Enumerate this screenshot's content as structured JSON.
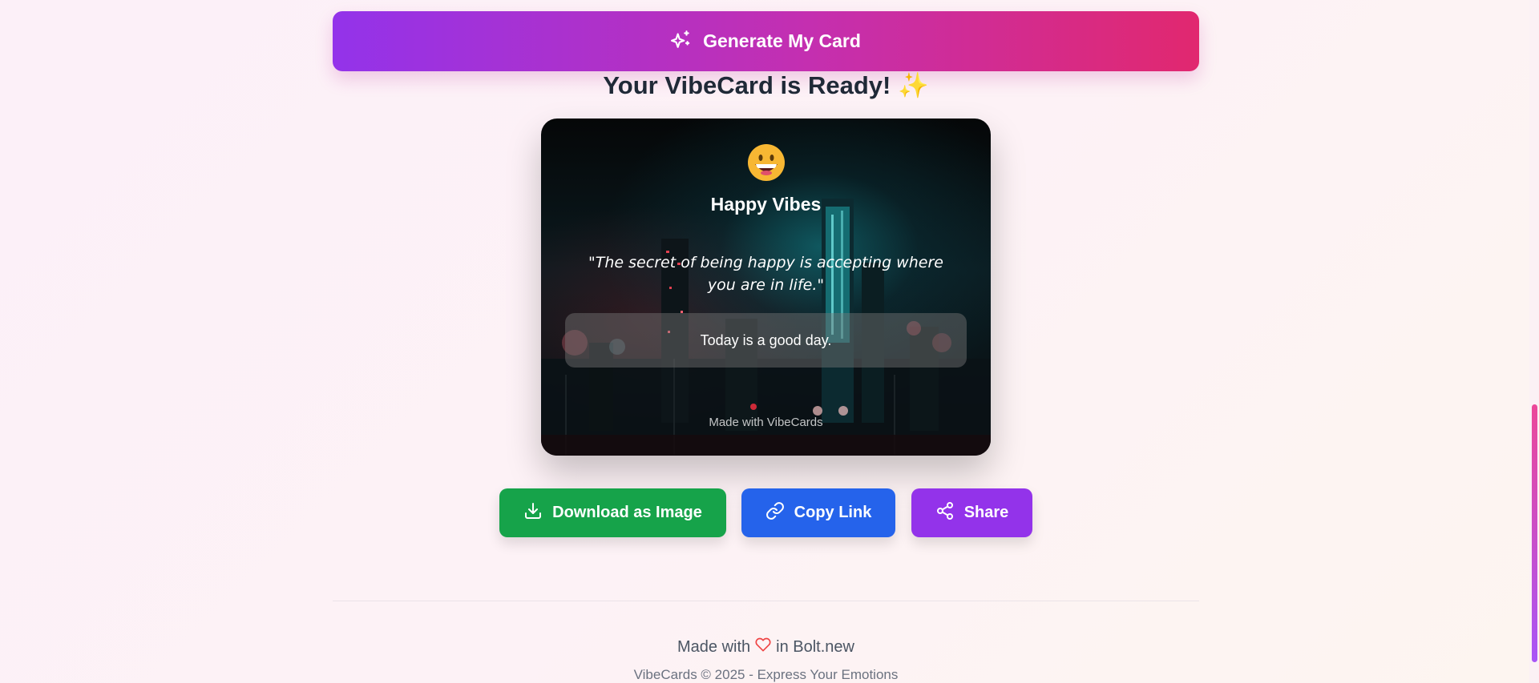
{
  "generate": {
    "label": "Generate My Card",
    "icon": "sparkles-icon"
  },
  "result": {
    "title": "Your VibeCard is Ready!",
    "title_emoji": "✨"
  },
  "card": {
    "emoji": "😄",
    "mood_title": "Happy Vibes",
    "quote": "\"The secret of being happy is accepting where you are in life.\"",
    "message": "Today is a good day.",
    "watermark": "Made with VibeCards",
    "background": "night city skyline"
  },
  "actions": {
    "download": {
      "label": "Download as Image",
      "icon": "download-icon",
      "color": "#16a34a"
    },
    "copy": {
      "label": "Copy Link",
      "icon": "link-icon",
      "color": "#2563eb"
    },
    "share": {
      "label": "Share",
      "icon": "share-icon",
      "color": "#9333ea"
    }
  },
  "footer": {
    "made_with_prefix": "Made with",
    "made_with_suffix": "in Bolt.new",
    "heart_icon": "heart-icon",
    "copyright": "VibeCards © 2025 - Express Your Emotions"
  },
  "colors": {
    "accent_start": "#9333ea",
    "accent_end": "#e1286f",
    "heart": "#ef4444"
  }
}
